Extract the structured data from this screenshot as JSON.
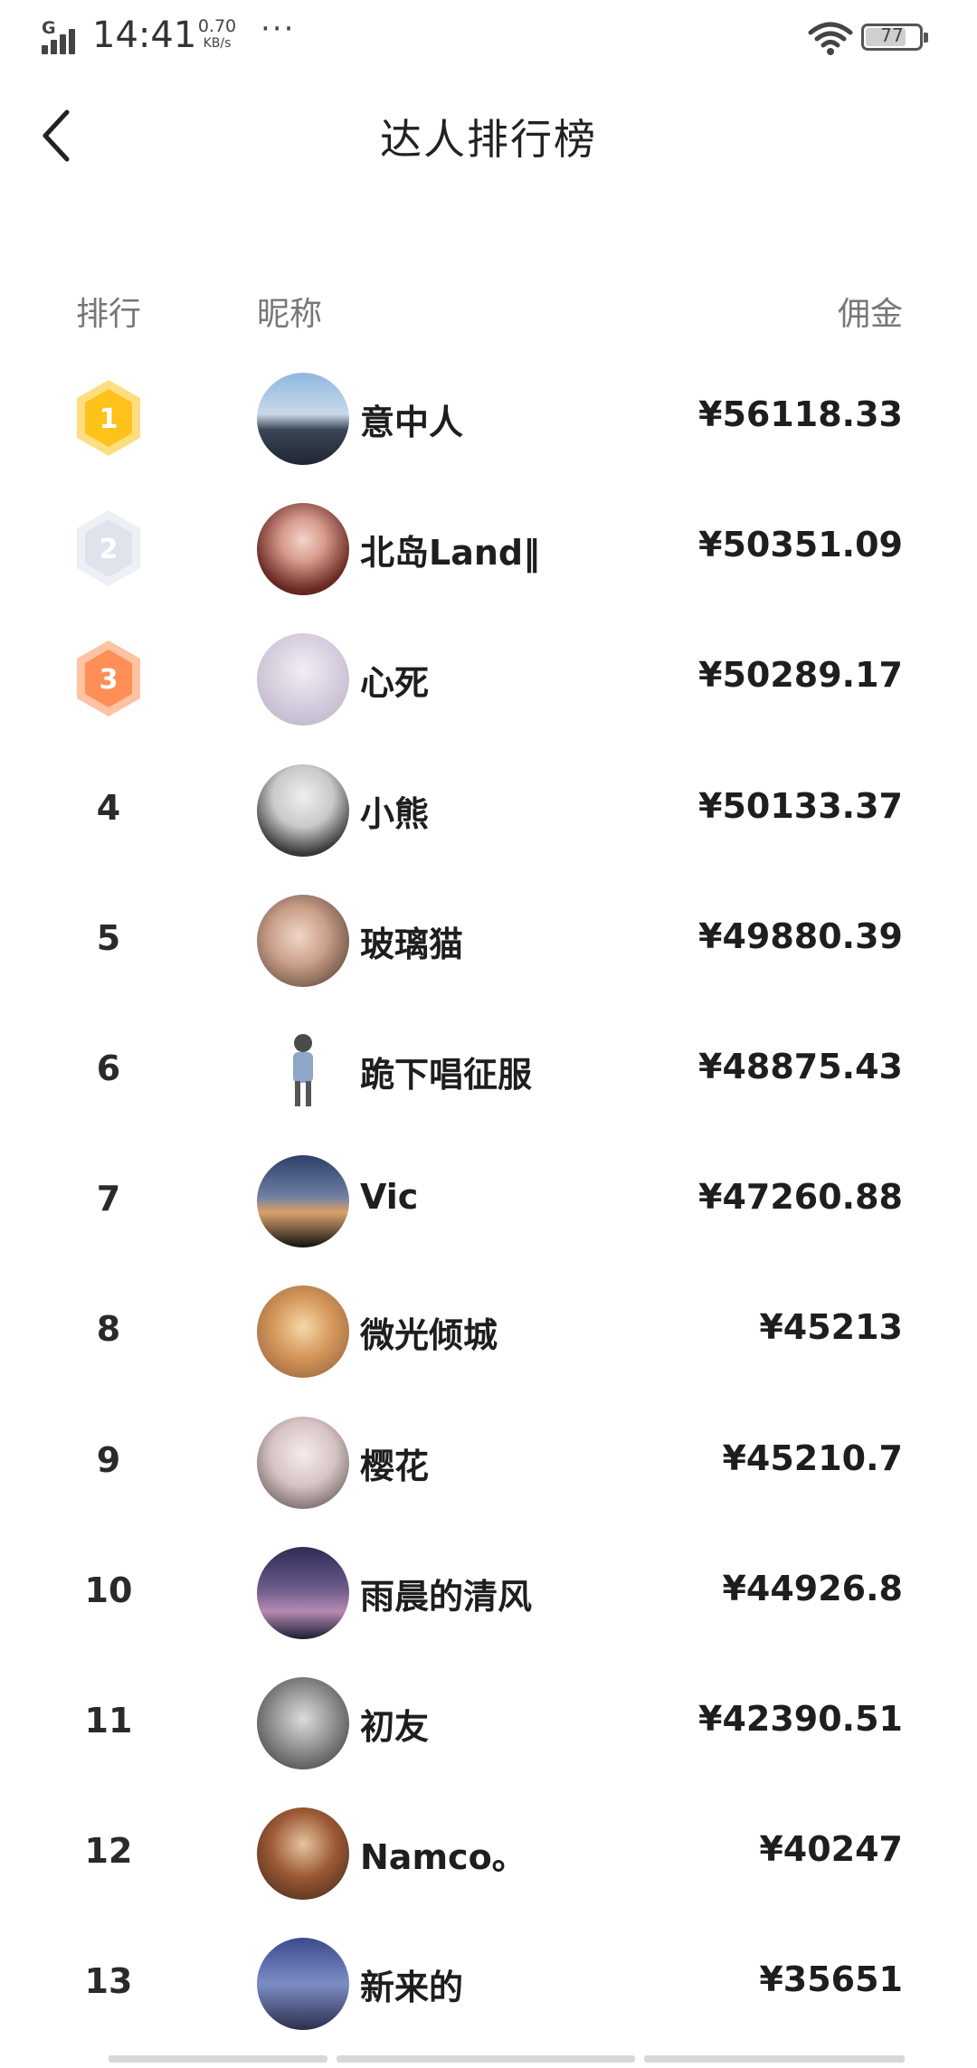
{
  "status_bar": {
    "network": "G",
    "time": "14:41",
    "speed_value": "0.70",
    "speed_unit": "KB/s",
    "more_dots": "···",
    "battery_level": "77",
    "battery_fraction": 0.77
  },
  "header": {
    "title": "达人排行榜"
  },
  "columns": {
    "rank": "排行",
    "nickname": "昵称",
    "commission": "佣金"
  },
  "medal_colors": {
    "gold": "#ffc21a",
    "silver": "#dfe3ec",
    "bronze": "#ff8f57"
  },
  "rows": [
    {
      "rank": "1",
      "nickname": "意中人",
      "commission": "¥56118.33"
    },
    {
      "rank": "2",
      "nickname": "北岛Land‖",
      "commission": "¥50351.09"
    },
    {
      "rank": "3",
      "nickname": "心死",
      "commission": "¥50289.17"
    },
    {
      "rank": "4",
      "nickname": "小熊",
      "commission": "¥50133.37"
    },
    {
      "rank": "5",
      "nickname": "玻璃猫",
      "commission": "¥49880.39"
    },
    {
      "rank": "6",
      "nickname": "跪下唱征服",
      "commission": "¥48875.43"
    },
    {
      "rank": "7",
      "nickname": "Vic",
      "commission": "¥47260.88"
    },
    {
      "rank": "8",
      "nickname": "微光倾城",
      "commission": "¥45213"
    },
    {
      "rank": "9",
      "nickname": "樱花",
      "commission": "¥45210.7"
    },
    {
      "rank": "10",
      "nickname": "雨晨的清风",
      "commission": "¥44926.8"
    },
    {
      "rank": "11",
      "nickname": "初友",
      "commission": "¥42390.51"
    },
    {
      "rank": "12",
      "nickname": "Namco。",
      "commission": "¥40247"
    },
    {
      "rank": "13",
      "nickname": "新来的",
      "commission": "¥35651"
    }
  ]
}
